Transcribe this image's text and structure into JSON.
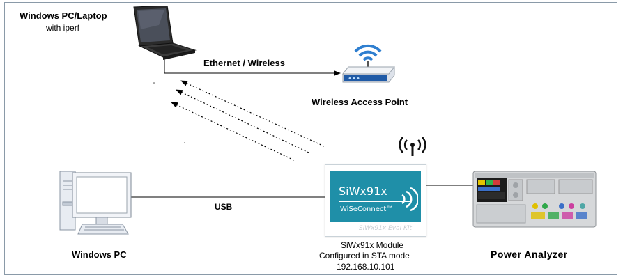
{
  "diagram": {
    "laptop": {
      "title": "Windows PC/Laptop",
      "subtitle": "with iperf"
    },
    "ethernet_label": "Ethernet / Wireless",
    "access_point_label": "Wireless Access Point",
    "usb_label": "USB",
    "windows_pc_label": "Windows PC",
    "module": {
      "chip_name": "SiWx91x",
      "brand": "WiSeConnect™",
      "kit_label": "SiWx91x Eval Kit",
      "caption_line1": "SiWx91x Module",
      "caption_line2": "Configured in STA mode",
      "ip": "192.168.10.101"
    },
    "power_analyzer_label": "Power Analyzer",
    "colors": {
      "module_card": "#1f8fa8",
      "frame_border": "#8a9aa8",
      "router_blue": "#1f5aa6",
      "pc_screen": "#3a66a8"
    }
  }
}
